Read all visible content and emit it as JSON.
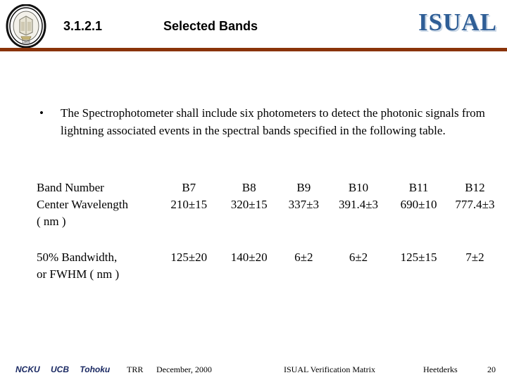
{
  "header": {
    "section_number": "3.1.2.1",
    "title": "Selected Bands",
    "project_logo": "ISUAL",
    "seal_icon": "university-seal-icon",
    "rule_color": "#8a3309",
    "logo_color": "#2f5e96"
  },
  "body": {
    "bullet_marker": "•",
    "bullet_text": "The Spectrophotometer shall include six photometers to detect the photonic signals from lightning associated events in the spectral bands specified in the following table."
  },
  "table": {
    "row_band": {
      "label": "Band Number",
      "values": [
        "B7",
        "B8",
        "B9",
        "B10",
        "B11",
        "B12"
      ]
    },
    "row_wavelength": {
      "label": "Center Wavelength",
      "label_units": "( nm )",
      "values": [
        "210±15",
        "320±15",
        "337±3",
        "391.4±3",
        "690±10",
        "777.4±3"
      ]
    },
    "row_bandwidth": {
      "label": "50% Bandwidth,",
      "label_units": "or FWHM ( nm )",
      "values": [
        "125±20",
        "140±20",
        "6±2",
        "6±2",
        "125±15",
        "7±2"
      ]
    }
  },
  "footer": {
    "orgs": [
      "NCKU",
      "UCB",
      "Tohoku"
    ],
    "doc_type": "TRR",
    "date": "December,  2000",
    "document": "ISUAL Verification Matrix",
    "author": "Heetderks",
    "page": "20",
    "orgs_color": "#1b2a63"
  }
}
